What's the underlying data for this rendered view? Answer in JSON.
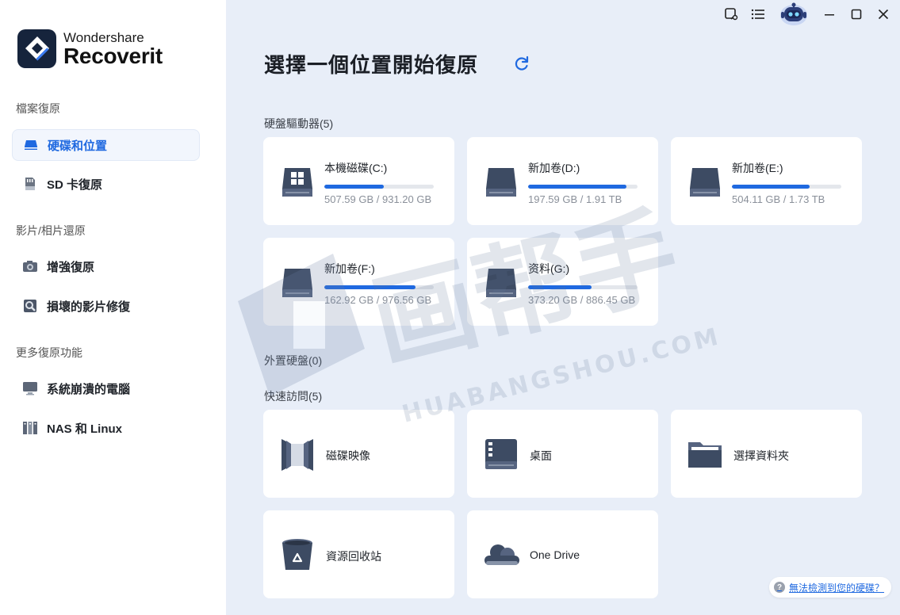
{
  "app": {
    "brand": "Wondershare",
    "product": "Recoverit"
  },
  "sidebar": {
    "sections": [
      {
        "title": "檔案復原",
        "items": [
          {
            "label": "硬碟和位置",
            "icon": "drive-icon",
            "active": true
          },
          {
            "label": "SD 卡復原",
            "icon": "sd-card-icon"
          }
        ]
      },
      {
        "title": "影片/相片還原",
        "items": [
          {
            "label": "增強復原",
            "icon": "camera-icon"
          },
          {
            "label": "損壞的影片修復",
            "icon": "video-repair-icon"
          }
        ]
      },
      {
        "title": "更多復原功能",
        "items": [
          {
            "label": "系統崩潰的電腦",
            "icon": "monitor-icon"
          },
          {
            "label": "NAS 和 Linux",
            "icon": "nas-icon"
          }
        ]
      }
    ]
  },
  "main": {
    "title": "選擇一個位置開始復原",
    "drives_label": "硬盤驅動器(5)",
    "drives": [
      {
        "name": "本機磁碟(C:)",
        "size": "507.59 GB / 931.20 GB",
        "used": 0.545,
        "icon": "windows-drive-icon"
      },
      {
        "name": "新加卷(D:)",
        "size": "197.59 GB / 1.91 TB",
        "used": 0.9,
        "icon": "drive-icon"
      },
      {
        "name": "新加卷(E:)",
        "size": "504.11 GB / 1.73 TB",
        "used": 0.71,
        "icon": "drive-icon"
      },
      {
        "name": "新加卷(F:)",
        "size": "162.92 GB / 976.56 GB",
        "used": 0.83,
        "icon": "drive-icon"
      },
      {
        "name": "资料(G:)",
        "size": "373.20 GB / 886.45 GB",
        "used": 0.58,
        "icon": "drive-icon"
      }
    ],
    "external_label": "外置硬盤(0)",
    "quick_label": "快速訪問(5)",
    "quick": [
      {
        "label": "磁碟映像",
        "icon": "disk-image-icon"
      },
      {
        "label": "桌面",
        "icon": "desktop-icon"
      },
      {
        "label": "選擇資料夾",
        "icon": "folder-icon"
      },
      {
        "label": "資源回收站",
        "icon": "recycle-bin-icon"
      },
      {
        "label": "One Drive",
        "icon": "onedrive-icon"
      }
    ],
    "help_link": "無法檢測到您的硬碟？"
  },
  "watermark": {
    "text": "画帮手",
    "subtext": "HUABANGSHOU.COM"
  },
  "colors": {
    "accent": "#1f69e0",
    "background": "#e8eef8",
    "card": "#ffffff",
    "drive_dark": "#3d4b63"
  }
}
